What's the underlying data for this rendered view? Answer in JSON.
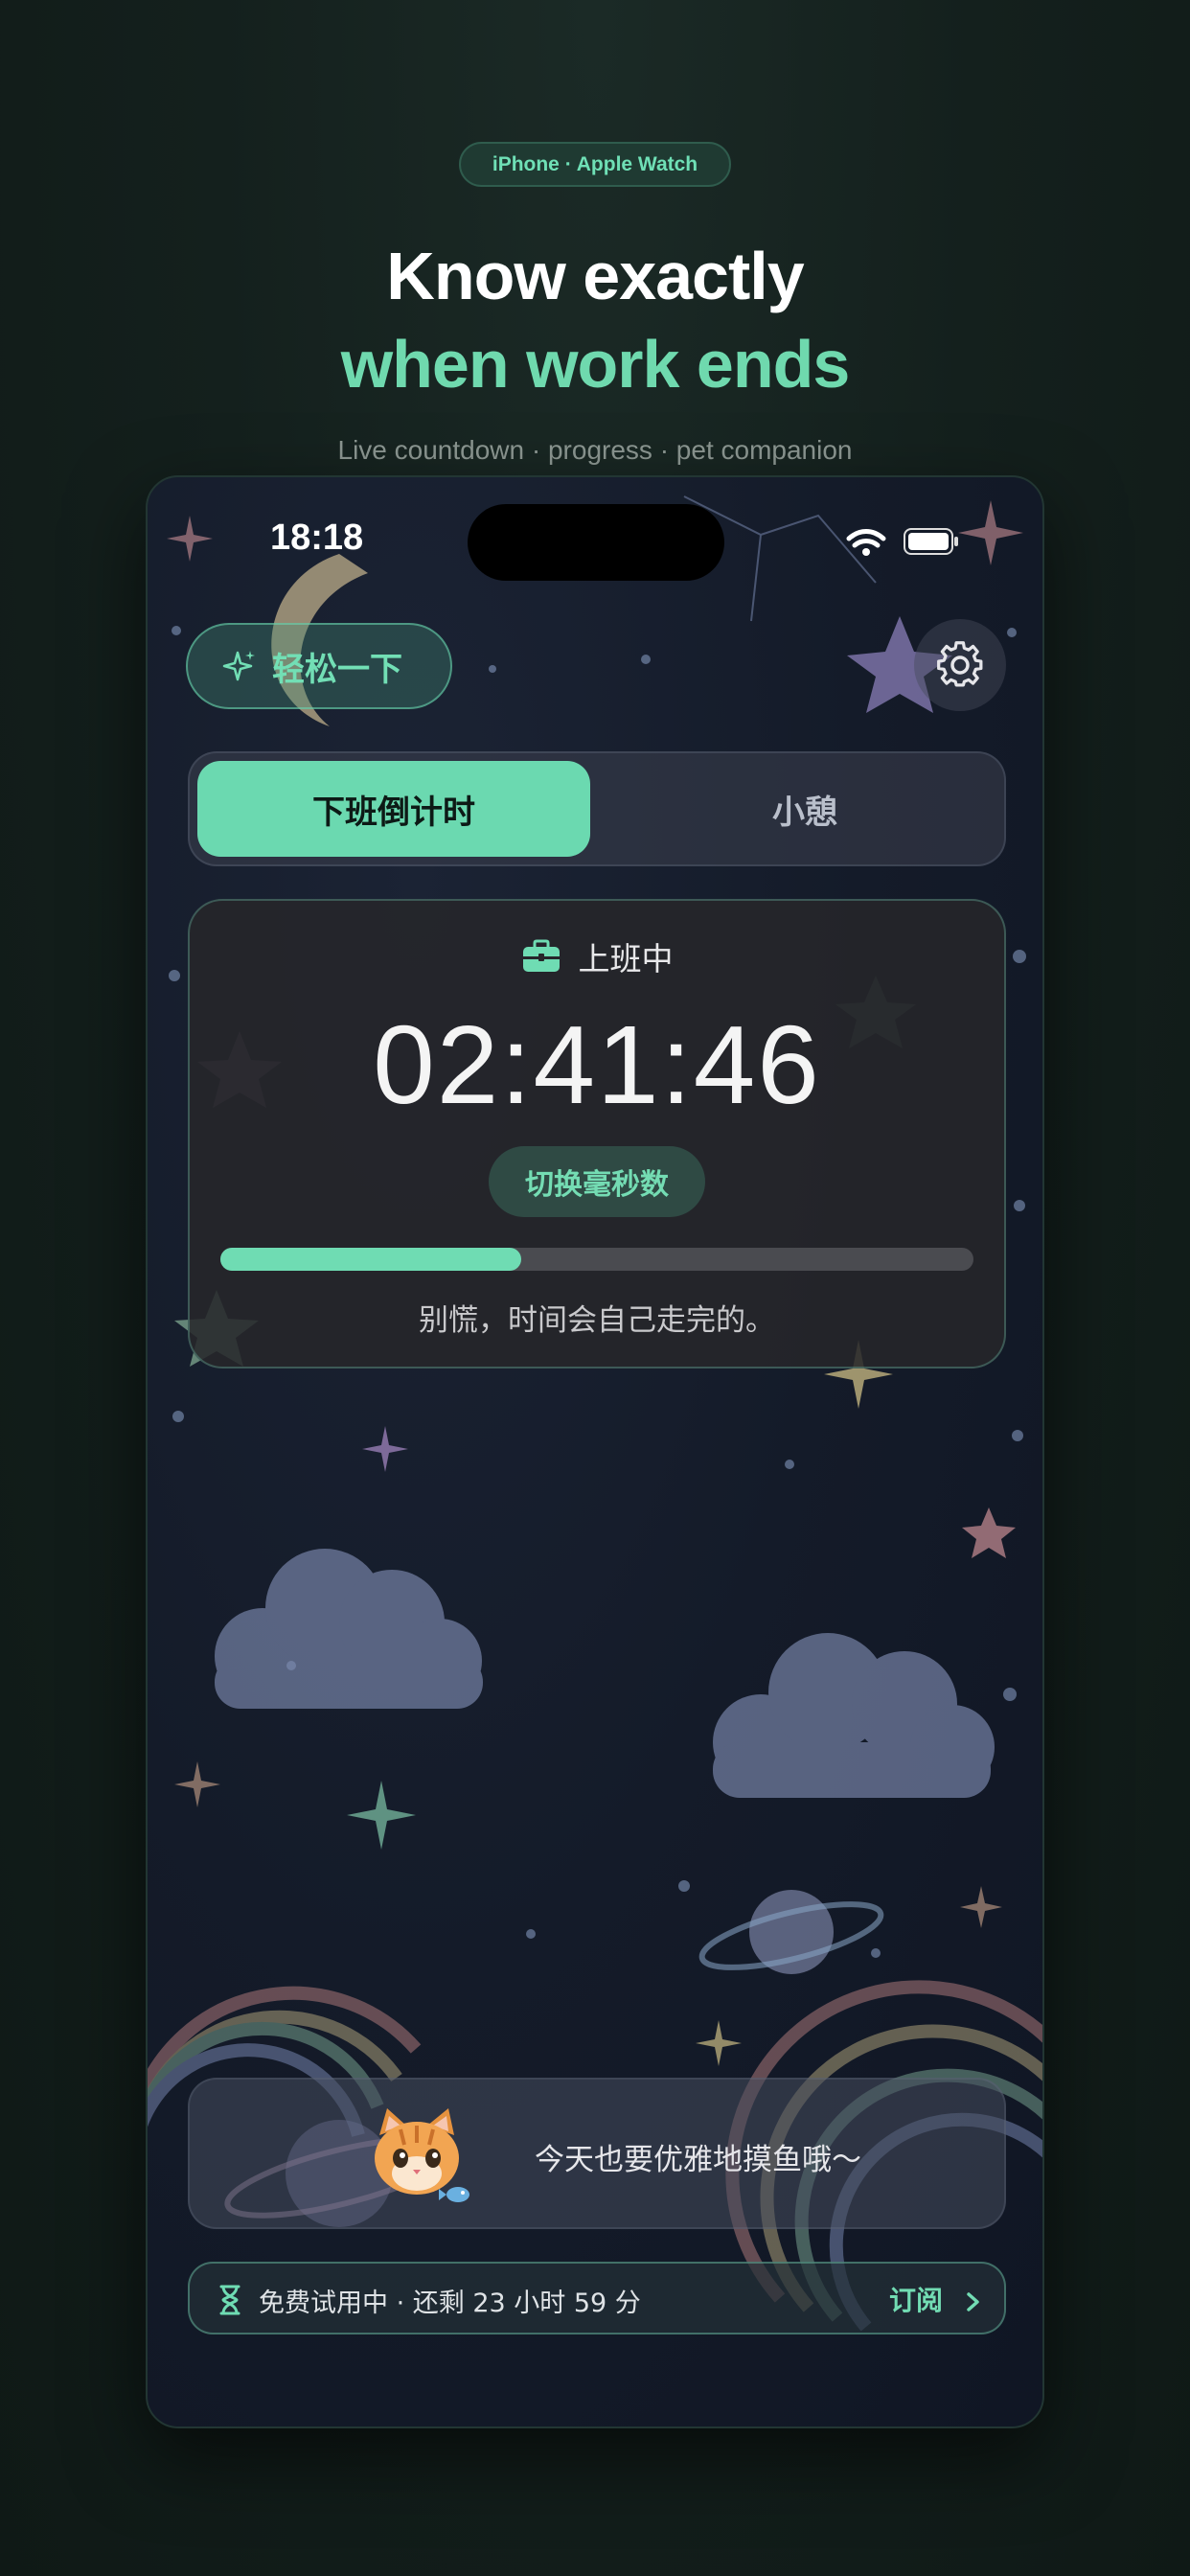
{
  "header": {
    "platform_badge": "iPhone · Apple Watch",
    "headline_line1": "Know exactly",
    "headline_line2": "when work ends",
    "subtitle": "Live countdown · progress · pet companion"
  },
  "status_bar": {
    "time": "18:18"
  },
  "top_bar": {
    "relax_label": "轻松一下",
    "relax_icon": "sparkle-icon",
    "settings_icon": "gear-icon"
  },
  "tabs": [
    {
      "label": "下班倒计时",
      "active": true
    },
    {
      "label": "小憩",
      "active": false
    }
  ],
  "countdown_card": {
    "status_label": "上班中",
    "status_icon": "briefcase-icon",
    "time_remaining": "02:41:46",
    "toggle_ms_label": "切换毫秒数",
    "progress": 0.4,
    "message": "别慌，时间会自己走完的。"
  },
  "pet": {
    "message": "今天也要优雅地摸鱼哦～",
    "avatar": "cat-avatar"
  },
  "trial_bar": {
    "text": "免费试用中 · 还剩 23 小时 59 分",
    "subscribe_label": "订阅",
    "icon": "hourglass-icon"
  },
  "colors": {
    "accent": "#6fd9ae",
    "background": "#14201d",
    "phone_bg": "#141b29",
    "card_bg": "#26262a"
  }
}
